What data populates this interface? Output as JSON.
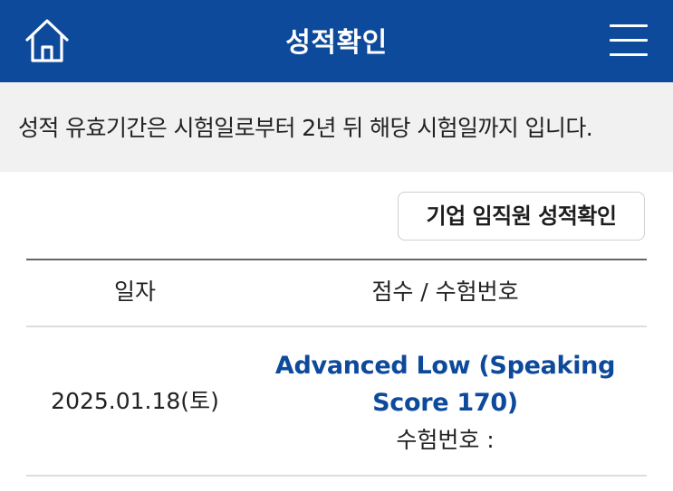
{
  "header": {
    "title": "성적확인",
    "home_icon": "home-icon",
    "menu_icon": "hamburger-menu-icon",
    "bg_color": "#0d4a9b"
  },
  "notice": {
    "text": "성적 유효기간은 시험일로부터 2년 뒤 해당 시험일까지 입니다."
  },
  "corporate_button": {
    "label": "기업 임직원 성적확인"
  },
  "table": {
    "columns": [
      "일자",
      "점수 / 수험번호"
    ],
    "rows": [
      {
        "date": "2025.01.18(토)",
        "score": "Advanced Low (Speaking Score 170)",
        "exam_number_label": "수험번호 :"
      }
    ]
  }
}
